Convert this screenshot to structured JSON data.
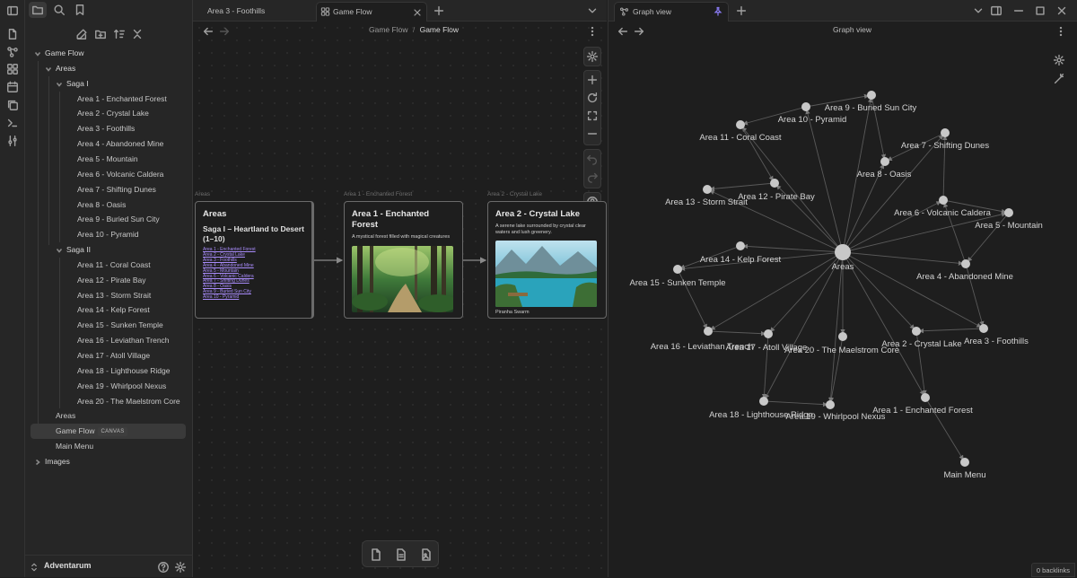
{
  "tabs": {
    "left_tab": "Area 3 - Foothills",
    "center_tab": "Game Flow",
    "right_tab": "Graph view"
  },
  "sidebar": {
    "tree": [
      {
        "label": "Game Flow",
        "level": 0,
        "type": "folder",
        "open": true
      },
      {
        "label": "Areas",
        "level": 1,
        "type": "folder",
        "open": true
      },
      {
        "label": "Saga I",
        "level": 2,
        "type": "folder",
        "open": true
      },
      {
        "label": "Area 1 - Enchanted Forest",
        "level": 3,
        "type": "file"
      },
      {
        "label": "Area 2 - Crystal Lake",
        "level": 3,
        "type": "file"
      },
      {
        "label": "Area 3 - Foothills",
        "level": 3,
        "type": "file"
      },
      {
        "label": "Area 4 - Abandoned Mine",
        "level": 3,
        "type": "file"
      },
      {
        "label": "Area 5 - Mountain",
        "level": 3,
        "type": "file"
      },
      {
        "label": "Area 6 - Volcanic Caldera",
        "level": 3,
        "type": "file"
      },
      {
        "label": "Area 7 - Shifting Dunes",
        "level": 3,
        "type": "file"
      },
      {
        "label": "Area 8 - Oasis",
        "level": 3,
        "type": "file"
      },
      {
        "label": "Area 9 - Buried Sun City",
        "level": 3,
        "type": "file"
      },
      {
        "label": "Area 10 - Pyramid",
        "level": 3,
        "type": "file"
      },
      {
        "label": "Saga II",
        "level": 2,
        "type": "folder",
        "open": true
      },
      {
        "label": "Area 11 - Coral Coast",
        "level": 3,
        "type": "file"
      },
      {
        "label": "Area 12 - Pirate Bay",
        "level": 3,
        "type": "file"
      },
      {
        "label": "Area 13 - Storm Strait",
        "level": 3,
        "type": "file"
      },
      {
        "label": "Area 14 - Kelp Forest",
        "level": 3,
        "type": "file"
      },
      {
        "label": "Area 15 - Sunken Temple",
        "level": 3,
        "type": "file"
      },
      {
        "label": "Area 16 - Leviathan Trench",
        "level": 3,
        "type": "file"
      },
      {
        "label": "Area 17 - Atoll Village",
        "level": 3,
        "type": "file"
      },
      {
        "label": "Area 18 - Lighthouse Ridge",
        "level": 3,
        "type": "file"
      },
      {
        "label": "Area 19 - Whirlpool Nexus",
        "level": 3,
        "type": "file"
      },
      {
        "label": "Area 20 - The Maelstrom Core",
        "level": 3,
        "type": "file"
      },
      {
        "label": "Areas",
        "level": 1,
        "type": "file"
      },
      {
        "label": "Game Flow",
        "level": 1,
        "type": "file",
        "selected": true,
        "badge": "CANVAS"
      },
      {
        "label": "Main Menu",
        "level": 1,
        "type": "file"
      },
      {
        "label": "Images",
        "level": 0,
        "type": "folder",
        "open": false
      }
    ],
    "vault_name": "Adventarum"
  },
  "canvas": {
    "breadcrumb_parent": "Game Flow",
    "breadcrumb_sep": "/",
    "breadcrumb_current": "Game Flow",
    "cards": [
      {
        "label": "Areas",
        "title": "Areas",
        "subtitle": "Saga I – Heartland to Desert (1–10)",
        "links": [
          "Area 1 - Enchanted Forest",
          "Area 2 - Crystal Lake",
          "Area 3 - Foothills",
          "Area 4 - Abandoned Mine",
          "Area 5 - Mountain",
          "Area 6 - Volcanic Caldera",
          "Area 7 - Shifting Dunes",
          "Area 8 - Oasis",
          "Area 9 - Buried Sun City",
          "Area 10 - Pyramid"
        ]
      },
      {
        "label": "Area 1 - Enchanted Forest",
        "title": "Area 1 - Enchanted Forest",
        "description": "A mystical forest filled with magical creatures"
      },
      {
        "label": "Area 2 - Crystal Lake",
        "title": "Area 2 - Crystal Lake",
        "description": "A serene lake surrounded by crystal clear waters and lush greenery.",
        "footer": "Piranha Swarm"
      }
    ]
  },
  "graph": {
    "title": "Graph view",
    "backlinks": "0 backlinks",
    "nodes": [
      {
        "label": "Areas",
        "big": true
      },
      {
        "label": "Area 9 - Buried Sun City"
      },
      {
        "label": "Area 10 - Pyramid"
      },
      {
        "label": "Area 11 - Coral Coast"
      },
      {
        "label": "Area 7 - Shifting Dunes"
      },
      {
        "label": "Area 8 - Oasis"
      },
      {
        "label": "Area 12 - Pirate Bay"
      },
      {
        "label": "Area 13 - Storm Strait"
      },
      {
        "label": "Area 6 - Volcanic Caldera"
      },
      {
        "label": "Area 5 - Mountain"
      },
      {
        "label": "Area 14 - Kelp Forest"
      },
      {
        "label": "Area 15 - Sunken Temple"
      },
      {
        "label": "Area 4 - Abandoned Mine"
      },
      {
        "label": "Area 16 - Leviathan Trench"
      },
      {
        "label": "Area 17 - Atoll Village"
      },
      {
        "label": "Area 20 - The Maelstrom Core"
      },
      {
        "label": "Area 2 - Crystal Lake"
      },
      {
        "label": "Area 3 - Foothills"
      },
      {
        "label": "Area 18 - Lighthouse Ridge"
      },
      {
        "label": "Area 19 - Whirlpool Nexus"
      },
      {
        "label": "Area 1 - Enchanted Forest"
      },
      {
        "label": "Main Menu"
      }
    ]
  },
  "colors": {
    "accent": "#a88bfa",
    "node": "#c8c8c8",
    "edge": "#5a5a5a"
  }
}
